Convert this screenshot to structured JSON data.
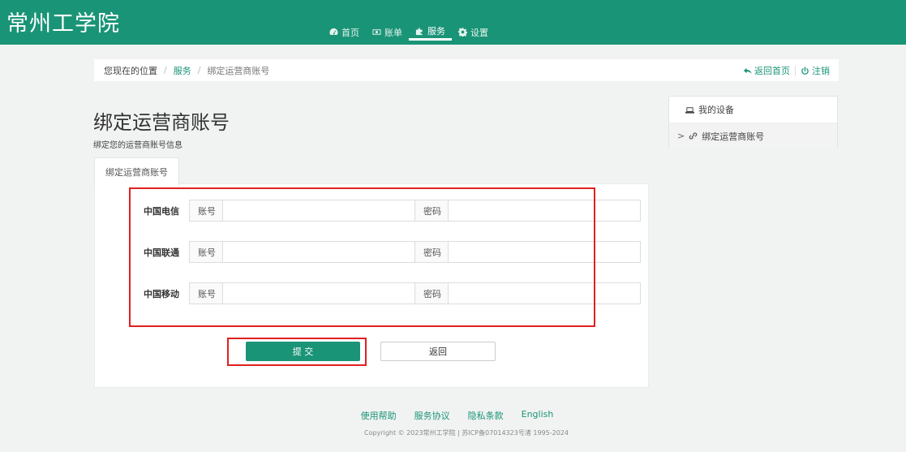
{
  "header": {
    "brand": "常州工学院",
    "nav": [
      {
        "label": "首页",
        "icon": "dashboard-icon"
      },
      {
        "label": "账单",
        "icon": "bill-icon"
      },
      {
        "label": "服务",
        "icon": "puzzle-icon",
        "active": true
      },
      {
        "label": "设置",
        "icon": "gear-icon"
      }
    ]
  },
  "breadcrumb": {
    "home": "您现在的位置",
    "section": "服务",
    "current": "绑定运营商账号",
    "back_home": "返回首页",
    "logout": "注销"
  },
  "page": {
    "title": "绑定运营商账号",
    "subtitle": "绑定您的运营商账号信息",
    "tab": "绑定运营商账号"
  },
  "form": {
    "rows": [
      {
        "carrier": "中国电信",
        "account_label": "账号",
        "account_value": "",
        "password_label": "密码",
        "password_value": ""
      },
      {
        "carrier": "中国联通",
        "account_label": "账号",
        "account_value": "",
        "password_label": "密码",
        "password_value": ""
      },
      {
        "carrier": "中国移动",
        "account_label": "账号",
        "account_value": "",
        "password_label": "密码",
        "password_value": ""
      }
    ],
    "submit": "提 交",
    "back": "返回"
  },
  "sidebar": {
    "items": [
      {
        "label": "我的设备",
        "icon": "laptop-icon"
      },
      {
        "label": "绑定运营商账号",
        "icon": "link-icon",
        "active": true,
        "marker": ">"
      }
    ]
  },
  "footer": {
    "links": [
      "使用帮助",
      "服务协议",
      "隐私条款",
      "English"
    ],
    "copyright": "Copyright © 2023常州工学院 | 苏ICP备07014323号渚 1995-2024"
  },
  "colors": {
    "primary": "#1a9477",
    "highlight": "#e02020"
  }
}
